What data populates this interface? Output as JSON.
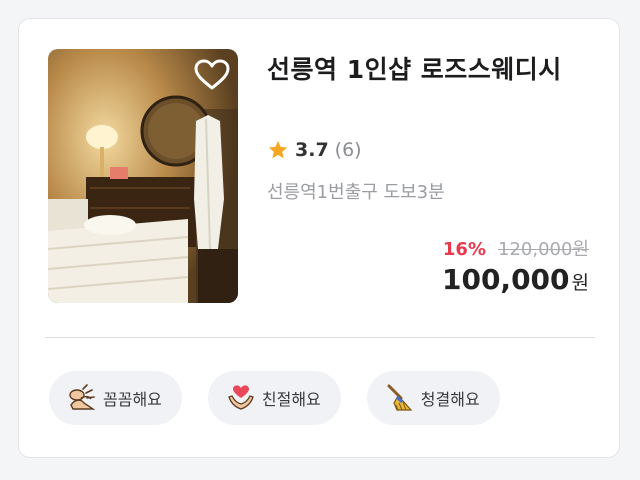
{
  "listing": {
    "title": "선릉역 1인샵 로즈스웨디시",
    "rating": "3.7",
    "review_count": "(6)",
    "location": "선릉역1번출구 도보3분",
    "discount": "16%",
    "original_price": "120,000원",
    "price": "100,000",
    "price_unit": "원",
    "favorited": false
  },
  "tags": [
    {
      "label": "꼼꼼해요",
      "icon": "massage-hands-icon"
    },
    {
      "label": "친절해요",
      "icon": "heart-hands-icon"
    },
    {
      "label": "청결해요",
      "icon": "broom-icon"
    }
  ],
  "colors": {
    "discount": "#e83a4f",
    "star": "#f5a623",
    "chip_bg": "#f1f2f5"
  }
}
